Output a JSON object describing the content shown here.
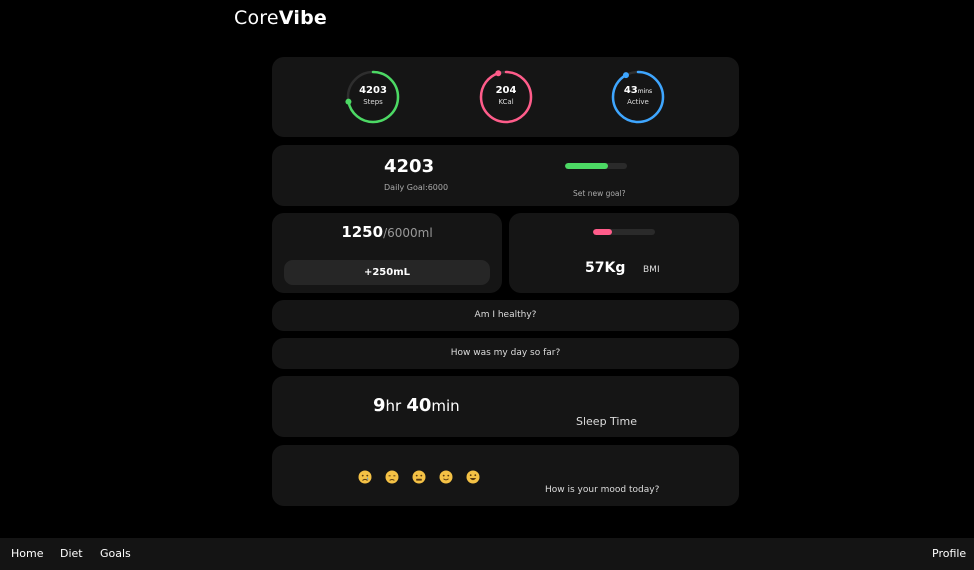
{
  "brand": {
    "prefix": "Core",
    "bold": "Vibe"
  },
  "rings": {
    "steps": {
      "value": "4203",
      "unit": "",
      "label": "Steps",
      "color": "#4cd964",
      "progress": 0.72
    },
    "kcal": {
      "value": "204",
      "unit": "",
      "label": "KCal",
      "color": "#ff5c8a",
      "progress": 0.95
    },
    "active": {
      "value": "43",
      "unit": "mins",
      "label": "Active",
      "color": "#3ea6ff",
      "progress": 0.92
    }
  },
  "steps_card": {
    "count": "4203",
    "goal_label": "Daily Goal:6000",
    "set_goal_label": "Set new goal?",
    "progress": 0.7,
    "bar_color": "#4cd964"
  },
  "water_card": {
    "amount": "1250",
    "total": "/6000ml",
    "add_button_label": "+250mL"
  },
  "weight_card": {
    "weight": "57Kg",
    "bmi_label": "BMI",
    "bar_progress": 0.3,
    "bar_color": "#ff5c8a"
  },
  "healthy_prompt": "Am I healthy?",
  "day_prompt": "How was my day so far?",
  "sleep_card": {
    "hours": "9",
    "hours_unit": "hr",
    "minutes": "40",
    "minutes_unit": "min",
    "label": "Sleep Time"
  },
  "mood_card": {
    "prompt": "How is your mood today?",
    "options": [
      "crying-face",
      "disappointed-face",
      "neutral-face",
      "slightly-smiling-face",
      "grinning-face"
    ]
  },
  "footer": {
    "nav": [
      "Home",
      "Diet",
      "Goals"
    ],
    "profile": "Profile"
  }
}
